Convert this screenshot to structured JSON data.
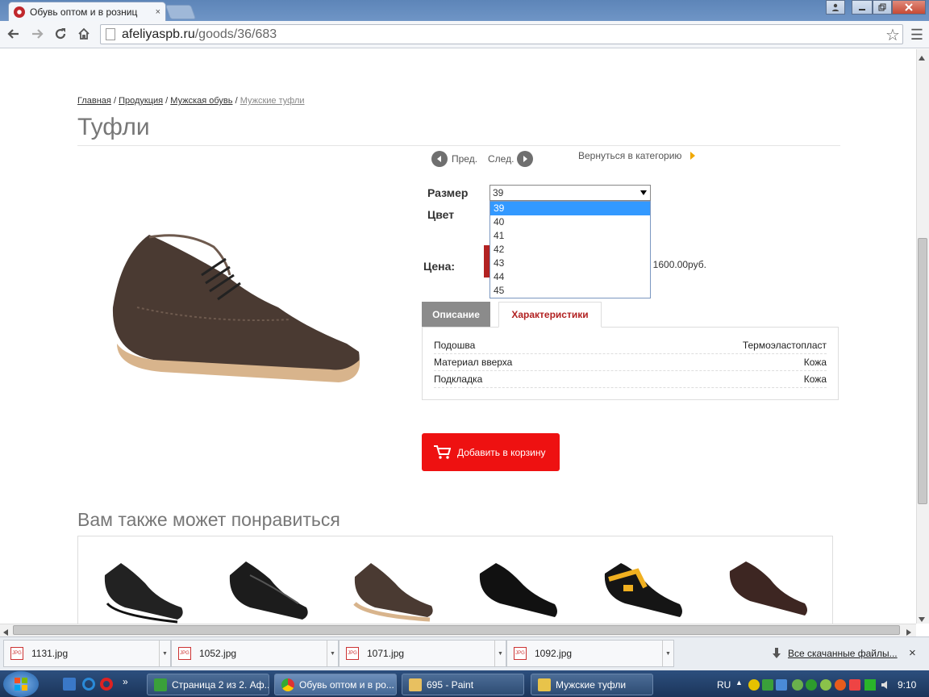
{
  "browser": {
    "tab_title": "Обувь оптом и в розниц",
    "tab_close": "×",
    "url_host": "afeliyaspb.ru",
    "url_path": "/goods/36/683",
    "star": "☆",
    "menu": "☰"
  },
  "breadcrumb": {
    "items": [
      "Главная",
      "Продукция",
      "Мужская обувь"
    ],
    "sep": "/",
    "current": "Мужские туфли"
  },
  "product": {
    "title": "Туфли",
    "prev_label": "Пред.",
    "next_label": "След.",
    "back_label": "Вернуться в категорию",
    "size_label": "Размер",
    "color_label": "Цвет",
    "price_label": "Цена:",
    "price_text": ": 1600.00руб.",
    "size_selected": "39",
    "size_options": [
      "39",
      "40",
      "41",
      "42",
      "43",
      "44",
      "45"
    ],
    "tab_description": "Описание",
    "tab_specs": "Характеристики",
    "specs": [
      {
        "name": "Подошва",
        "value": "Термоэластопласт"
      },
      {
        "name": "Материал вверха",
        "value": "Кожа"
      },
      {
        "name": "Подкладка",
        "value": "Кожа"
      }
    ],
    "cart_button": "Добавить в корзину"
  },
  "recommend": {
    "title": "Вам также может понравиться"
  },
  "downloads": {
    "files": [
      "1131.jpg",
      "1052.jpg",
      "1071.jpg",
      "1092.jpg"
    ],
    "file_badge": "JPG",
    "all_label": "Все скачанные файлы...",
    "close": "×"
  },
  "taskbar": {
    "items": [
      "Страница 2 из 2. Аф...",
      "Обувь оптом и в ро...",
      "695 - Paint",
      "Мужские туфли"
    ],
    "lang": "RU",
    "time": "9:10"
  },
  "colors": {
    "accent_red": "#ee1111",
    "tab_active_text": "#b22222",
    "select_highlight": "#3399ff"
  }
}
